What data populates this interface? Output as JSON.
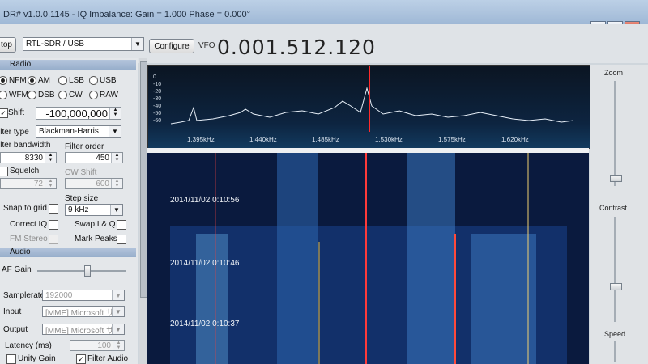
{
  "window": {
    "title": "DR# v1.0.0.1145 - IQ Imbalance: Gain = 1.000 Phase = 0.000°"
  },
  "toolbar": {
    "stop_label": "top",
    "device": "RTL-SDR / USB",
    "configure_label": "Configure",
    "vfo_label": "VFO",
    "vfo_value": "0.001.512.120"
  },
  "radio": {
    "section_label": "Radio",
    "modes": [
      {
        "label": "NFM",
        "selected": true
      },
      {
        "label": "AM",
        "selected": true
      },
      {
        "label": "LSB",
        "selected": false
      },
      {
        "label": "USB",
        "selected": false
      },
      {
        "label": "WFM",
        "selected": false
      },
      {
        "label": "DSB",
        "selected": false
      },
      {
        "label": "CW",
        "selected": false
      },
      {
        "label": "RAW",
        "selected": false
      }
    ],
    "shift_label": "Shift",
    "shift_value": "-100,000,000",
    "filter_type_label": "ilter type",
    "filter_type_value": "Blackman-Harris",
    "filter_bandwidth_label": "ilter bandwidth",
    "filter_bandwidth_value": "8330",
    "filter_order_label": "Filter order",
    "filter_order_value": "450",
    "squelch_label": "Squelch",
    "squelch_value": "72",
    "cw_shift_label": "CW Shift",
    "cw_shift_value": "600",
    "snap_label": "Snap to grid",
    "step_size_label": "Step size",
    "step_size_value": "9 kHz",
    "correct_iq_label": "Correct IQ",
    "swap_iq_label": "Swap I & Q",
    "fm_stereo_label": "FM Stereo",
    "mark_peaks_label": "Mark Peaks"
  },
  "audio": {
    "section_label": "Audio",
    "af_gain_label": "AF Gain",
    "af_gain_level": 0.55,
    "samplerate_label": "Samplerate",
    "samplerate_value": "192000",
    "input_label": "Input",
    "input_value": "[MME] Microsoft サウ",
    "output_label": "Output",
    "output_value": "[MME] Microsoft サウ",
    "latency_label": "Latency (ms)",
    "latency_value": "100",
    "unity_gain_label": "Unity Gain",
    "filter_audio_label": "Filter Audio"
  },
  "spectrum": {
    "y_ticks": [
      "0",
      "-10",
      "-20",
      "-30",
      "-40",
      "-50",
      "-60"
    ],
    "x_ticks": [
      "1,395kHz",
      "1,440kHz",
      "1,485kHz",
      "1,530kHz",
      "1,575kHz",
      "1,620kHz"
    ]
  },
  "waterfall": {
    "timestamps": [
      "2014/11/02 0:10:56",
      "2014/11/02 0:10:46",
      "2014/11/02 0:10:37"
    ]
  },
  "right": {
    "zoom_label": "Zoom",
    "contrast_label": "Contrast",
    "speed_label": "Speed"
  },
  "colors": {
    "accent": "#9fb8d6",
    "spectrum_bg": "#0d2440",
    "waterfall_bg": "#0a1a3e",
    "marker": "#ff2a2a"
  }
}
